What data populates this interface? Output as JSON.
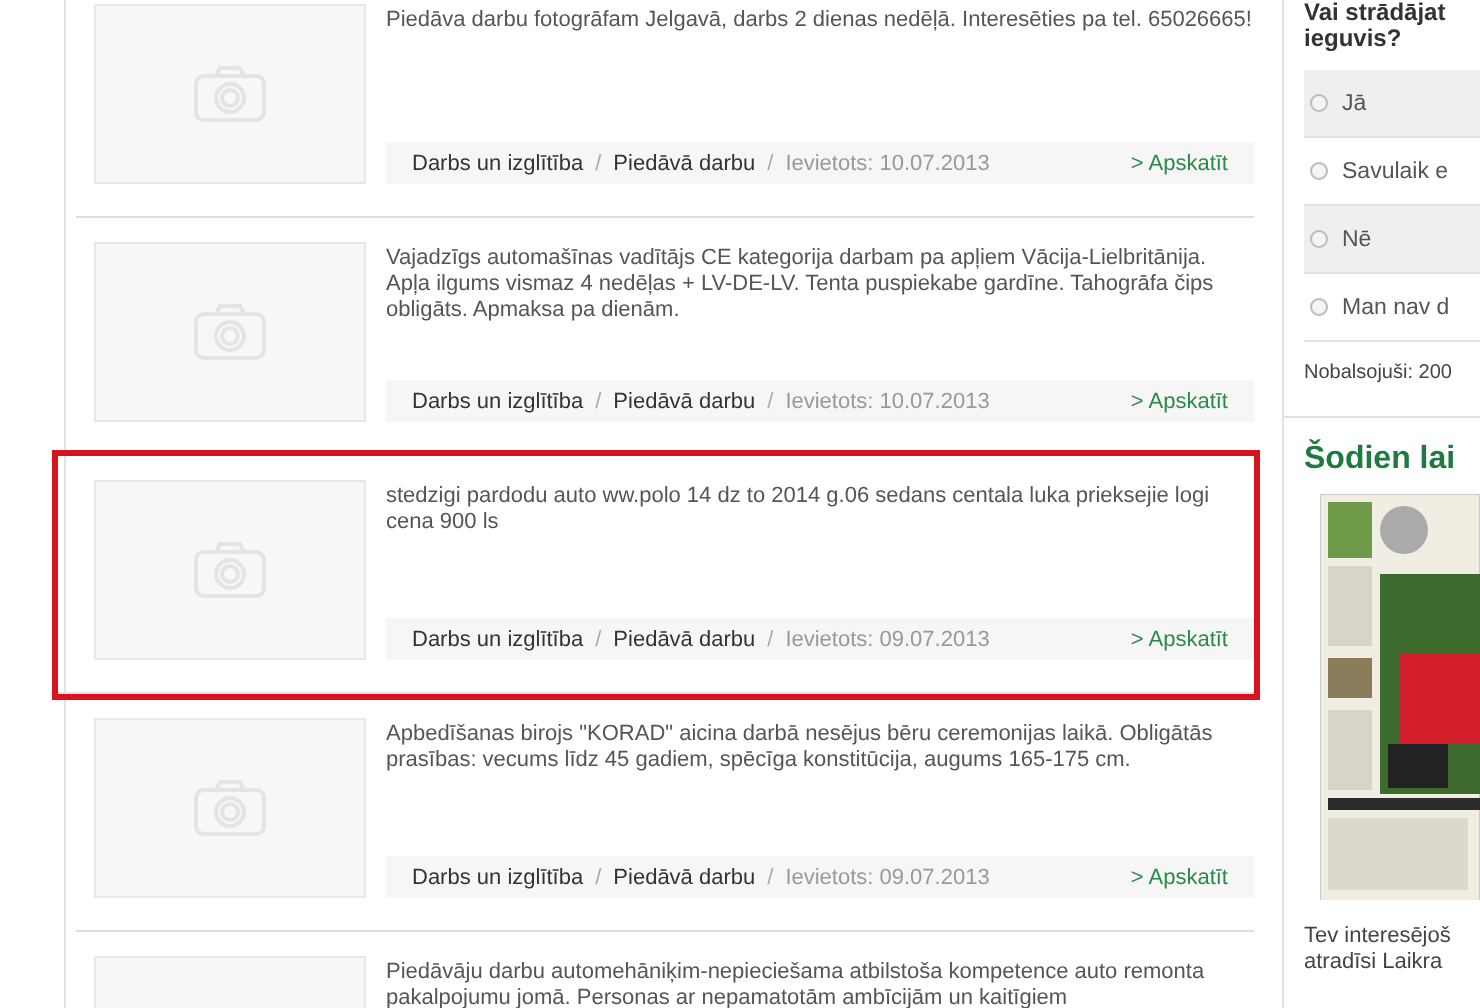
{
  "listings": [
    {
      "text": "Piedāva darbu fotogrāfam Jelgavā, darbs 2 dienas nedēļā. Interesēties pa tel. 65026665!",
      "category": "Darbs un izglītība",
      "subcategory": "Piedāvā darbu",
      "date": "Ievietots: 10.07.2013",
      "link": "> Apskatīt",
      "separator": "/",
      "highlighted": false
    },
    {
      "text": "Vajadzīgs automašīnas vadītājs CE kategorija darbam pa apļiem Vācija-Lielbritānija. Apļa ilgums vismaz 4 nedēļas + LV-DE-LV. Tenta puspiekabe gardīne. Tahogrāfa čips obligāts. Apmaksa pa dienām.",
      "category": "Darbs un izglītība",
      "subcategory": "Piedāvā darbu",
      "date": "Ievietots: 10.07.2013",
      "link": "> Apskatīt",
      "separator": "/",
      "highlighted": false
    },
    {
      "text": "stedzigi pardodu auto ww.polo 14 dz to 2014 g.06 sedans centala luka prieksejie logi cena 900 ls",
      "category": "Darbs un izglītība",
      "subcategory": "Piedāvā darbu",
      "date": "Ievietots: 09.07.2013",
      "link": "> Apskatīt",
      "separator": "/",
      "highlighted": true
    },
    {
      "text": "Apbedīšanas birojs \"KORAD\" aicina darbā nesējus bēru ceremonijas laikā. Obligātās prasības: vecums līdz 45 gadiem, spēcīga konstitūcija, augums 165-175 cm.",
      "category": "Darbs un izglītība",
      "subcategory": "Piedāvā darbu",
      "date": "Ievietots: 09.07.2013",
      "link": "> Apskatīt",
      "separator": "/",
      "highlighted": false
    },
    {
      "text": "Piedāvāju darbu automehāniķim-nepieciešama atbilstoša kompetence auto remonta pakalpojumu jomā. Personas ar nepamatotām ambīcijām un kaitīgiem",
      "highlighted": false
    }
  ],
  "poll": {
    "question_lines": [
      "Vai strādājat",
      "ieguvis?"
    ],
    "options": [
      {
        "label": "Jā",
        "selected": false
      },
      {
        "label": "Savulaik e",
        "selected": false
      },
      {
        "label": "Nē",
        "selected": false
      },
      {
        "label": "Man nav d",
        "selected": false
      }
    ],
    "votes": "Nobalsojuši: 200"
  },
  "newspaper": {
    "heading": "Šodien lai",
    "caption_lines": [
      "Tev interesējoš",
      "atradīsi Laikra"
    ]
  }
}
